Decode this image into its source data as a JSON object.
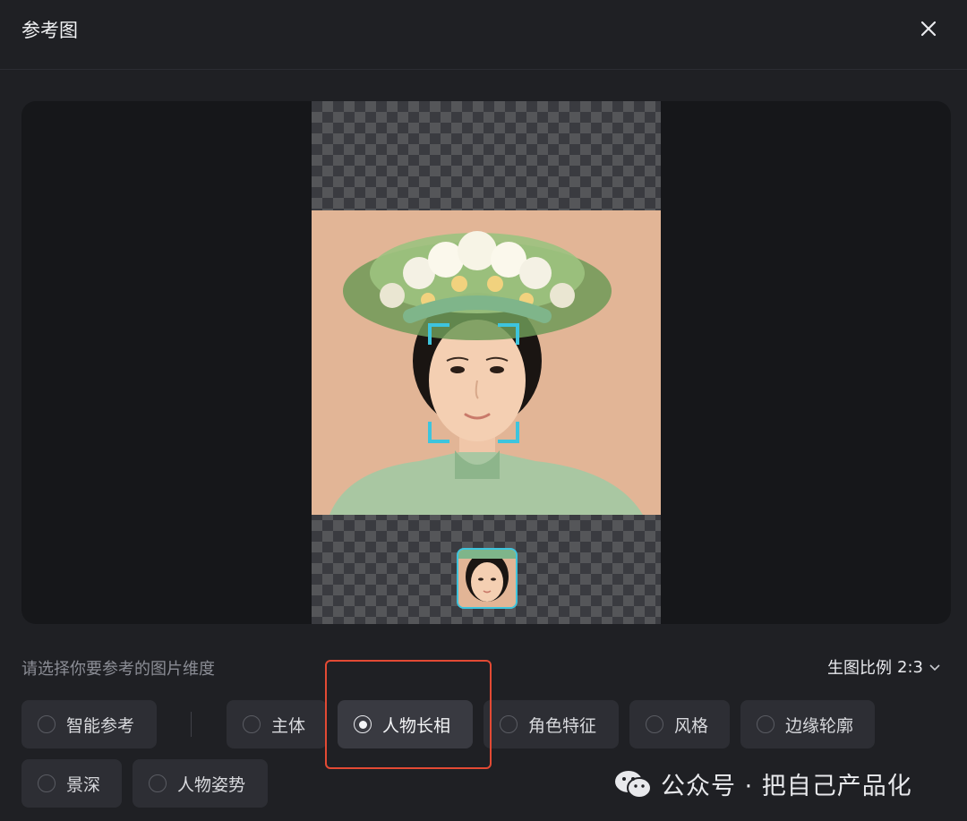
{
  "dialog": {
    "title": "参考图"
  },
  "hint_text": "请选择你要参考的图片维度",
  "ratio": {
    "label": "生图比例",
    "value": "2:3"
  },
  "options": [
    {
      "label": "智能参考",
      "selected": false
    },
    {
      "label": "主体",
      "selected": false
    },
    {
      "label": "人物长相",
      "selected": true
    },
    {
      "label": "角色特征",
      "selected": false
    },
    {
      "label": "风格",
      "selected": false
    },
    {
      "label": "边缘轮廓",
      "selected": false
    },
    {
      "label": "景深",
      "selected": false
    },
    {
      "label": "人物姿势",
      "selected": false
    }
  ],
  "watermark": {
    "text": "公众号 · 把自己产品化",
    "icon": "wechat-icon"
  },
  "colors": {
    "accent": "#3ec4dd",
    "highlight": "#e34a34",
    "background": "#1f2024"
  }
}
